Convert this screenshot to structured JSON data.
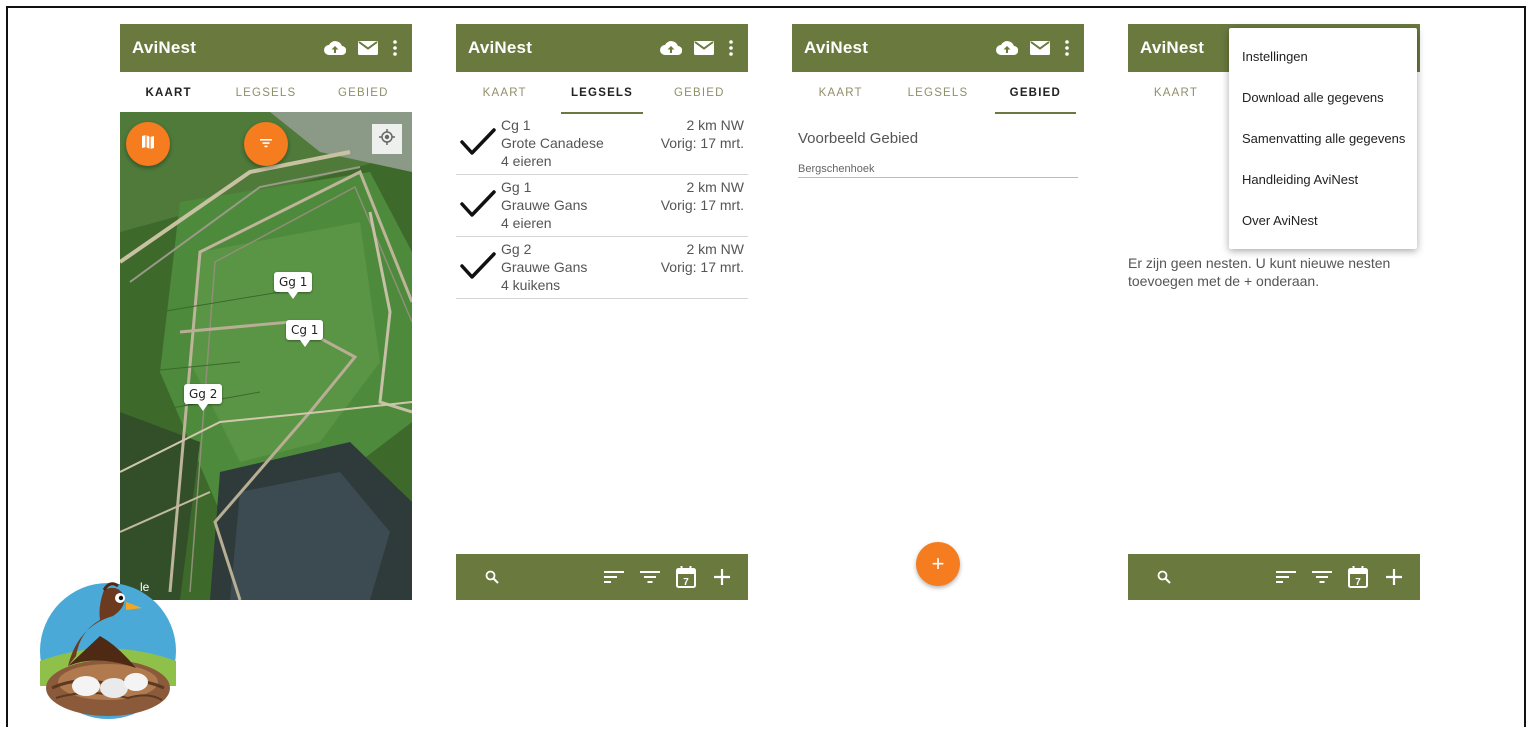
{
  "app": {
    "title": "AviNest"
  },
  "tabs": {
    "kaart": "KAART",
    "legsels": "LEGSELS",
    "gebied": "GEBIED"
  },
  "map": {
    "markers": [
      "Gg 1",
      "Cg 1",
      "Gg 2"
    ],
    "attribution": "le"
  },
  "legsels": [
    {
      "code": "Cg 1",
      "species": "Grote Canadese",
      "count": "4 eieren",
      "distance": "2 km NW",
      "previous": "Vorig: 17 mrt."
    },
    {
      "code": "Gg 1",
      "species": "Grauwe Gans",
      "count": "4 eieren",
      "distance": "2 km NW",
      "previous": "Vorig: 17 mrt."
    },
    {
      "code": "Gg 2",
      "species": "Grauwe Gans",
      "count": "4 kuikens",
      "distance": "2 km NW",
      "previous": "Vorig: 17 mrt."
    }
  ],
  "gebied": {
    "name": "Voorbeeld Gebied",
    "location": "Bergschenhoek"
  },
  "empty_message": "Er zijn geen nesten. U kunt nieuwe nesten toevoegen met de + onderaan.",
  "menu": {
    "items": [
      "Instellingen",
      "Download alle gegevens",
      "Samenvatting alle gegevens",
      "Handleiding AviNest",
      "Over AviNest"
    ]
  },
  "bottombar": {
    "calendar_day": "7"
  },
  "fab_plus": "+",
  "colors": {
    "primary": "#6a7a3f",
    "accent": "#f57c1f"
  },
  "icons": [
    "cloud-upload-icon",
    "mail-icon",
    "more-vert-icon",
    "map-icon",
    "filter-icon",
    "my-location-icon",
    "search-icon",
    "sort-icon",
    "calendar-icon",
    "plus-icon",
    "check-icon"
  ]
}
